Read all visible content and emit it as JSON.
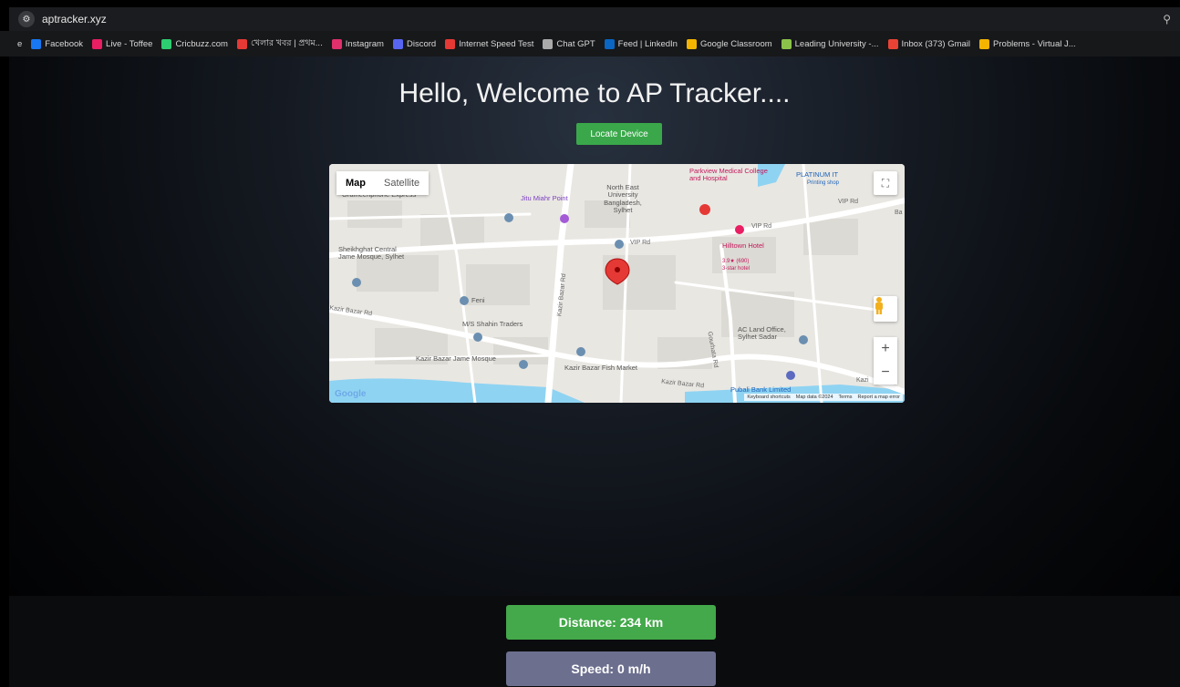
{
  "browser": {
    "url": "aptracker.xyz",
    "bookmarks": [
      {
        "label": "e",
        "color": "#17181a"
      },
      {
        "label": "Facebook",
        "color": "#1877f2"
      },
      {
        "label": "Live - Toffee",
        "color": "#e91e63"
      },
      {
        "label": "Cricbuzz.com",
        "color": "#2ecc71"
      },
      {
        "label": "খেলার খবর | প্রথম...",
        "color": "#e53935"
      },
      {
        "label": "Instagram",
        "color": "#e1306c"
      },
      {
        "label": "Discord",
        "color": "#5865f2"
      },
      {
        "label": "Internet Speed Test",
        "color": "#e53935"
      },
      {
        "label": "Chat GPT",
        "color": "#aaaaaa"
      },
      {
        "label": "Feed | LinkedIn",
        "color": "#0a66c2"
      },
      {
        "label": "Google Classroom",
        "color": "#f4b400"
      },
      {
        "label": "Leading University -...",
        "color": "#8bc34a"
      },
      {
        "label": "Inbox (373) Gmail",
        "color": "#ea4335"
      },
      {
        "label": "Problems - Virtual J...",
        "color": "#f4b400"
      }
    ]
  },
  "page": {
    "title": "Hello, Welcome to AP Tracker....",
    "locate_button": "Locate Device"
  },
  "map": {
    "type_map": "Map",
    "type_satellite": "Satellite",
    "zoom_in": "+",
    "zoom_out": "−",
    "labels": {
      "grameenphone": "Grameenphone Express",
      "jitu": "Jitu Miahr Point",
      "neu": "North East University Bangladesh, Sylhet",
      "parkview": "Parkview Medical College and Hospital",
      "platinum": "PLATINUM IT",
      "platinum_sub": "Printing shop",
      "vip1": "VIP Rd",
      "vip2": "VIP Rd",
      "vip3": "VIP Rd",
      "hilltown": "Hilltown Hotel",
      "hilltown_rating": "3.9★ (690)",
      "hilltown_type": "3-star hotel",
      "sheikhghat": "Sheikhghat Central Jame Mosque, Sylhet",
      "feni": "Feni",
      "kazir_road": "Kazir Bazar Rd",
      "kazir_road2": "Kazir Bazar Rd",
      "kazir_road3": "Kazir Bazar Rd",
      "shahin": "M/S Shahin Traders",
      "kazir_mosque": "Kazir Bazar Jame Mosque",
      "fish_market": "Kazir Bazar Fish Market",
      "ac_land": "AC Land Office, Sylhet Sadar",
      "pubali": "Pubali Bank Limited",
      "gourhata": "Gourhata Rd",
      "kazi": "Kazi",
      "ba": "Ba"
    },
    "google": "Google",
    "attribution": {
      "shortcuts": "Keyboard shortcuts",
      "data": "Map data ©2024",
      "terms": "Terms",
      "report": "Report a map error"
    },
    "colors": {
      "marker": "#e53935",
      "water": "#8fd3f2",
      "road": "#ffffff"
    }
  },
  "stats": {
    "distance": "Distance: 234 km",
    "speed": "Speed: 0 m/h",
    "distance_color": "#43a94a",
    "speed_color": "#6c6f8e"
  }
}
